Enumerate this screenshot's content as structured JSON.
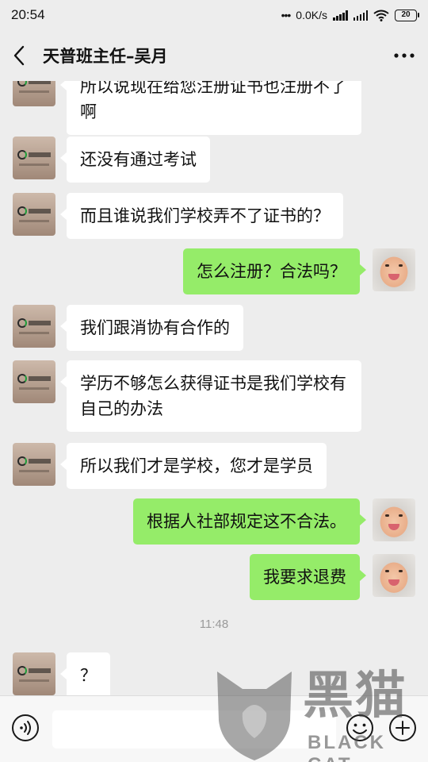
{
  "status_bar": {
    "time": "20:54",
    "net_speed": "0.0K/s",
    "battery": "20"
  },
  "header": {
    "title": "天普班主任–吴月"
  },
  "messages": [
    {
      "side": "left",
      "avatar": "school-logo",
      "text": "所以说现在给您注册证书也注册不了啊"
    },
    {
      "side": "left",
      "avatar": "school-logo",
      "text": "还没有通过考试"
    },
    {
      "side": "left",
      "avatar": "school-logo",
      "text": "而且谁说我们学校弄不了证书的？"
    },
    {
      "side": "right",
      "avatar": "baby-photo",
      "text": "怎么注册？合法吗？"
    },
    {
      "side": "left",
      "avatar": "school-logo",
      "text": "我们跟消协有合作的"
    },
    {
      "side": "left",
      "avatar": "school-logo",
      "text": "学历不够怎么获得证书是我们学校有自己的办法"
    },
    {
      "side": "left",
      "avatar": "school-logo",
      "text": "所以我们才是学校，您才是学员"
    },
    {
      "side": "right",
      "avatar": "baby-photo",
      "text": "根据人社部规定这不合法。"
    },
    {
      "side": "right",
      "avatar": "baby-photo",
      "text": "我要求退费"
    },
    {
      "side": "left",
      "avatar": "school-logo",
      "text": "？"
    }
  ],
  "timestamp": "11:48",
  "input_bar": {
    "placeholder": ""
  },
  "watermark": {
    "brand_cn": "黑猫",
    "brand_en": "BLACK CAT"
  },
  "colors": {
    "background": "#ededed",
    "bubble_self": "#95ec69",
    "bubble_other": "#ffffff",
    "timestamp": "#9a9a9a"
  }
}
